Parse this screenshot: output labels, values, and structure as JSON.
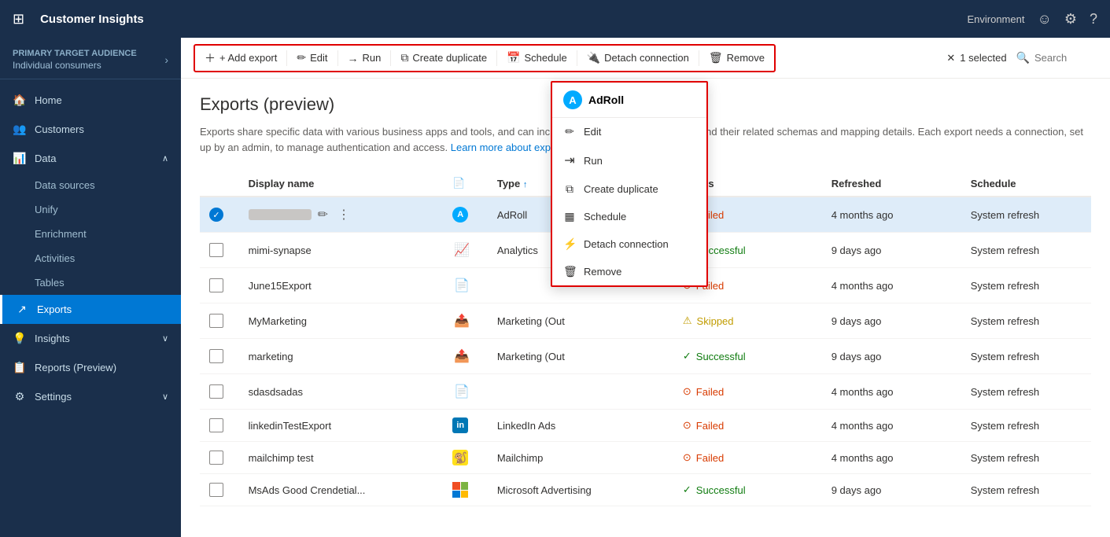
{
  "app": {
    "title": "Customer Insights",
    "environment": "Environment"
  },
  "sidebar": {
    "audience_label": "Primary target audience",
    "audience_value": "Individual consumers",
    "items": [
      {
        "id": "home",
        "label": "Home",
        "icon": "🏠",
        "active": false
      },
      {
        "id": "customers",
        "label": "Customers",
        "icon": "👥",
        "active": false
      },
      {
        "id": "data",
        "label": "Data",
        "icon": "📊",
        "active": false,
        "expanded": true
      },
      {
        "id": "data-sources",
        "label": "Data sources",
        "sub": true
      },
      {
        "id": "unify",
        "label": "Unify",
        "sub": true
      },
      {
        "id": "enrichment",
        "label": "Enrichment",
        "sub": true
      },
      {
        "id": "activities",
        "label": "Activities",
        "sub": true
      },
      {
        "id": "tables",
        "label": "Tables",
        "sub": true
      },
      {
        "id": "exports",
        "label": "Exports",
        "active": true
      },
      {
        "id": "insights",
        "label": "Insights",
        "icon": "💡",
        "active": false,
        "expandable": true
      },
      {
        "id": "reports",
        "label": "Reports (Preview)",
        "icon": "📋",
        "active": false
      },
      {
        "id": "settings",
        "label": "Settings",
        "icon": "⚙",
        "active": false,
        "expandable": true
      }
    ]
  },
  "toolbar": {
    "add_export": "+ Add export",
    "edit": "Edit",
    "run": "Run",
    "create_duplicate": "Create duplicate",
    "schedule": "Schedule",
    "detach_connection": "Detach connection",
    "remove": "Remove",
    "selected_count": "1 selected",
    "search_placeholder": "Search"
  },
  "page": {
    "title": "Exports (preview)",
    "description": "Exports share specific data with various business apps and tools, and can include customer profiles or entities and their related schemas and mapping details. Each export needs a connection, set up by an admin, to manage authentication and access.",
    "learn_more": "Learn more about exports and connections"
  },
  "table": {
    "columns": [
      "Display name",
      "",
      "Type",
      "Status",
      "Refreshed",
      "Schedule"
    ],
    "rows": [
      {
        "name": "",
        "blurred": true,
        "type_icon": "adroll",
        "type": "AdRoll",
        "status": "Failed",
        "status_type": "failed",
        "refreshed": "4 months ago",
        "schedule": "System refresh",
        "selected": true
      },
      {
        "name": "mimi-synapse",
        "type_icon": "analytics",
        "type": "Analytics",
        "status": "Successful",
        "status_type": "success",
        "refreshed": "9 days ago",
        "schedule": "System refresh"
      },
      {
        "name": "June15Export",
        "type_icon": "",
        "type": "",
        "status": "Failed",
        "status_type": "failed",
        "refreshed": "4 months ago",
        "schedule": "System refresh"
      },
      {
        "name": "MyMarketing",
        "type_icon": "outbound",
        "type": "Marketing (Out",
        "status": "Skipped",
        "status_type": "skipped",
        "refreshed": "9 days ago",
        "schedule": "System refresh"
      },
      {
        "name": "marketing",
        "type_icon": "outbound",
        "type": "Marketing (Out",
        "status": "Successful",
        "status_type": "success",
        "refreshed": "9 days ago",
        "schedule": "System refresh"
      },
      {
        "name": "sdasdsadas",
        "type_icon": "",
        "type": "",
        "status": "Failed",
        "status_type": "failed",
        "refreshed": "4 months ago",
        "schedule": "System refresh"
      },
      {
        "name": "linkedinTestExport",
        "type_icon": "linkedin",
        "type": "LinkedIn Ads",
        "status": "Failed",
        "status_type": "failed",
        "refreshed": "4 months ago",
        "schedule": "System refresh"
      },
      {
        "name": "mailchimp test",
        "type_icon": "mailchimp",
        "type": "Mailchimp",
        "status": "Failed",
        "status_type": "failed",
        "refreshed": "4 months ago",
        "schedule": "System refresh"
      },
      {
        "name": "MsAds Good Crendetial...",
        "type_icon": "msads",
        "type": "Microsoft Advertising",
        "status": "Successful",
        "status_type": "success",
        "refreshed": "9 days ago",
        "schedule": "System refresh"
      }
    ]
  },
  "context_menu": {
    "header": "AdRoll",
    "items": [
      {
        "label": "Edit",
        "icon": "✏"
      },
      {
        "label": "Run",
        "icon": "→"
      },
      {
        "label": "Create duplicate",
        "icon": "⧉"
      },
      {
        "label": "Schedule",
        "icon": "📅"
      },
      {
        "label": "Detach connection",
        "icon": "🔌"
      },
      {
        "label": "Remove",
        "icon": "🗑"
      }
    ]
  }
}
